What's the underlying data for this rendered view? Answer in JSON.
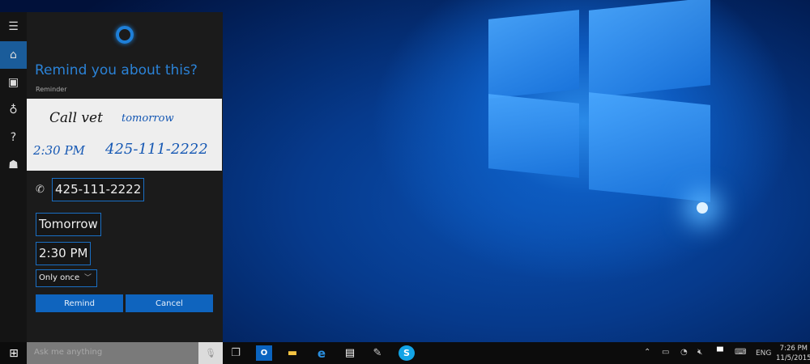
{
  "cortana": {
    "title": "Remind you about this?",
    "subtitle": "Reminder",
    "handwriting": {
      "line1_black": "Call vet",
      "line1_blue": "tomorrow",
      "line2_time": "2:30 PM",
      "line2_phone": "425-111-2222"
    },
    "phone": "425-111-2222",
    "day": "Tomorrow",
    "time": "2:30 PM",
    "repeat": "Only once",
    "remind_label": "Remind",
    "cancel_label": "Cancel",
    "rail": [
      "menu-icon",
      "home-icon",
      "notebook-icon",
      "lightbulb-icon",
      "help-icon",
      "feedback-icon"
    ]
  },
  "taskbar": {
    "search_placeholder": "Ask me anything",
    "apps": [
      "task-view",
      "outlook",
      "file-explorer",
      "edge",
      "store",
      "pen-app",
      "skype"
    ],
    "language": "ENG",
    "clock_time": "7:26 PM",
    "clock_date": "11/5/2015"
  },
  "colors": {
    "accent": "#1a6fc4",
    "button": "#0f64be",
    "title": "#2b82d6"
  }
}
